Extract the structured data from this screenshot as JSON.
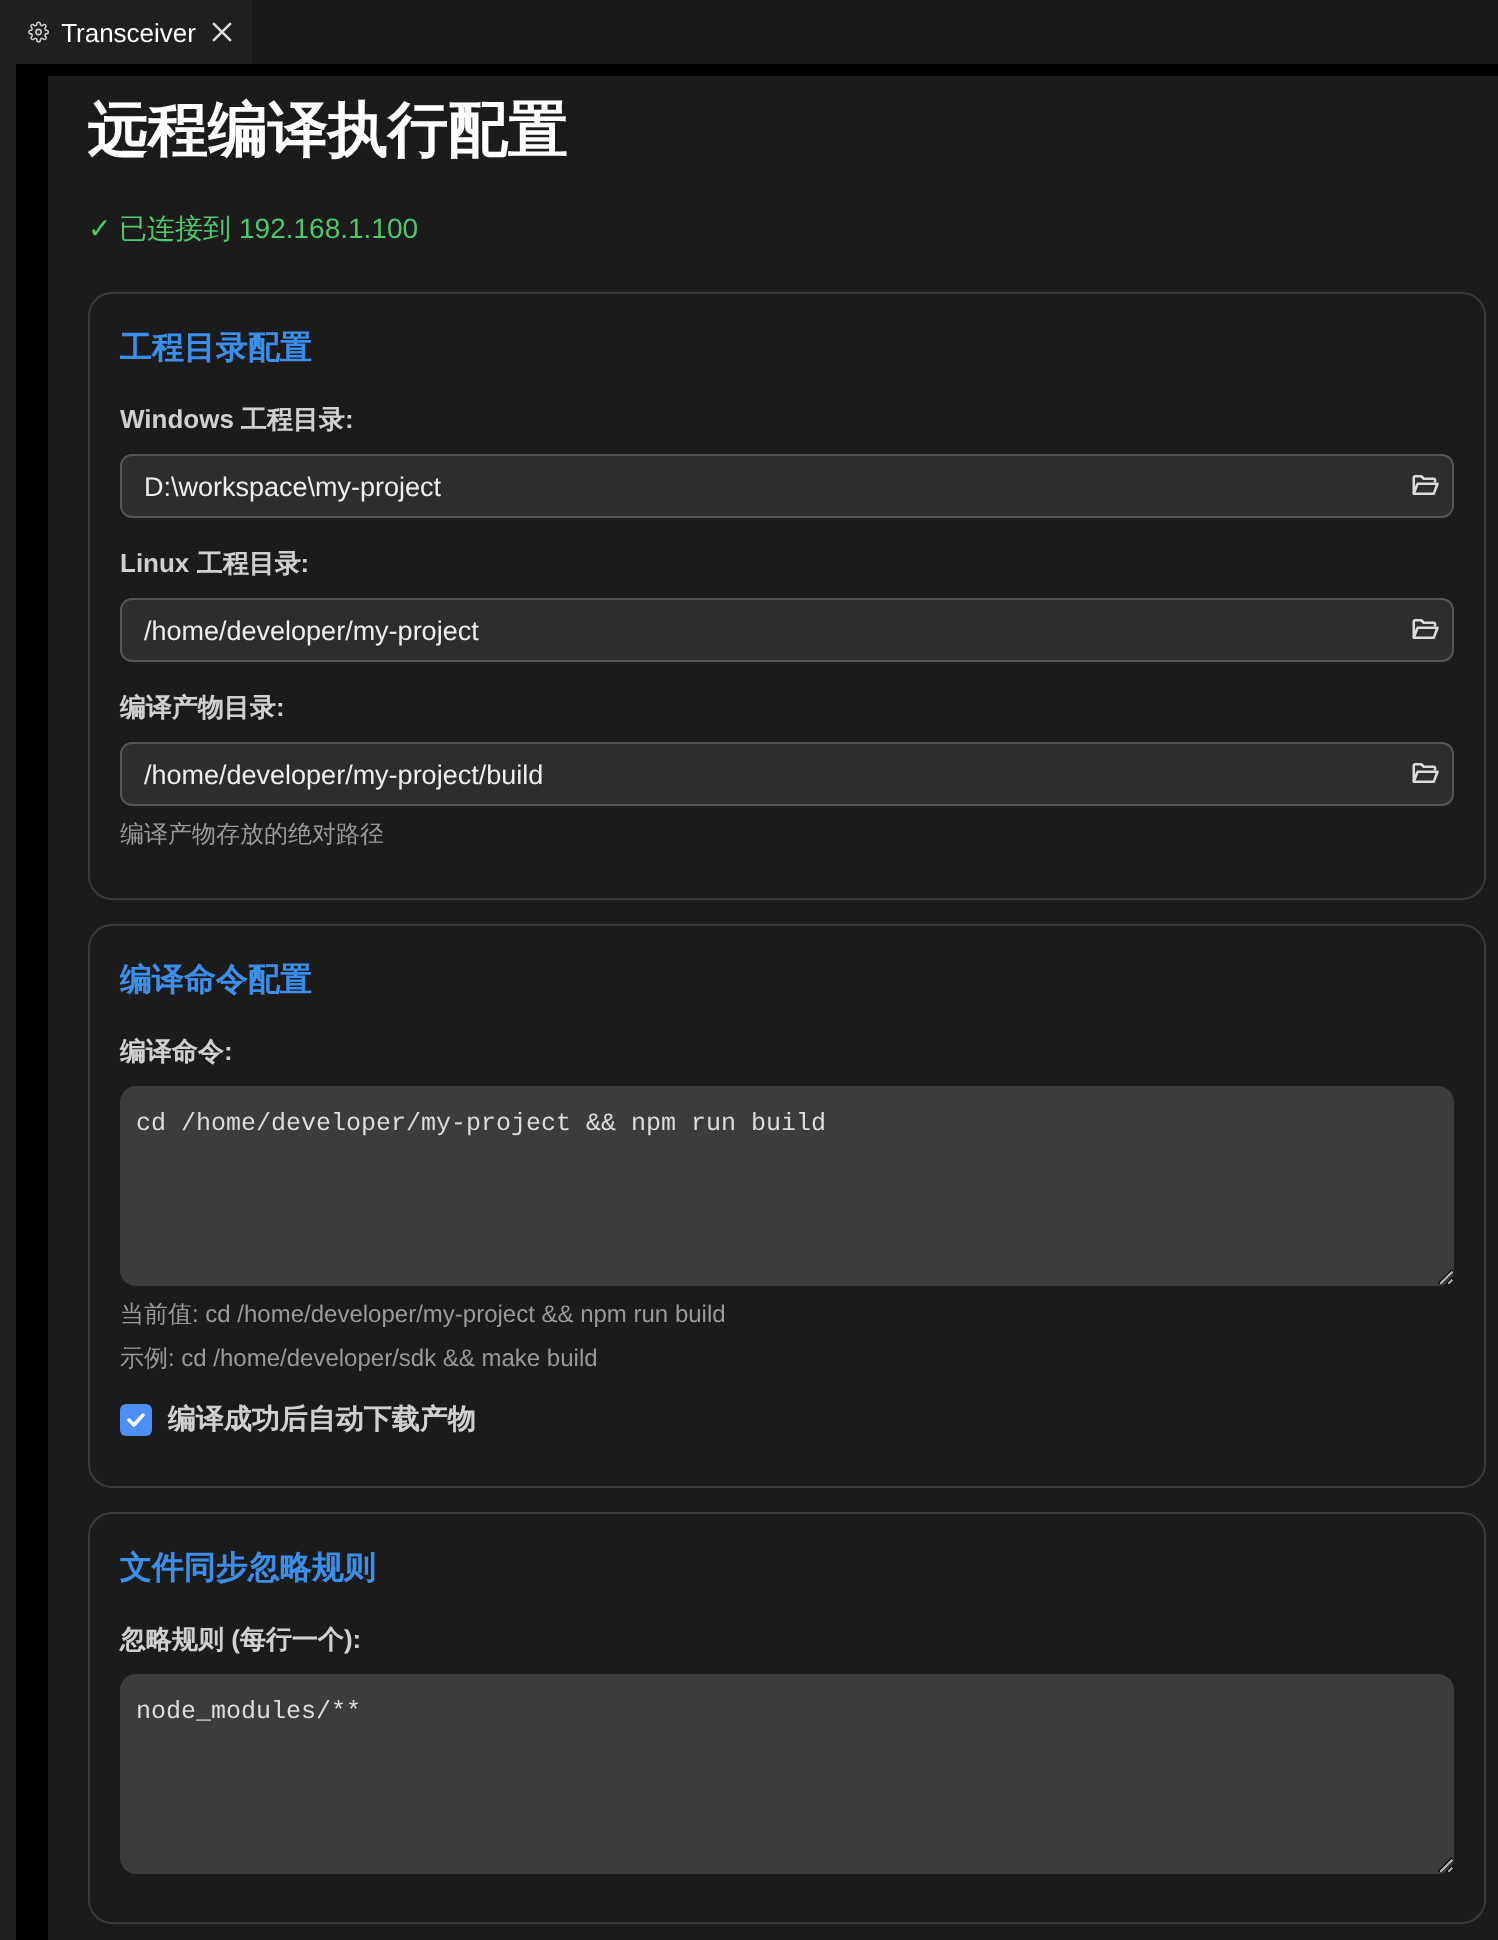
{
  "tab": {
    "title": "Transceiver",
    "selected": true
  },
  "page": {
    "title": "远程编译执行配置",
    "status": "✓ 已连接到 192.168.1.100"
  },
  "sections": [
    {
      "title": "工程目录配置",
      "fields": [
        {
          "kind": "path",
          "label": "Windows 工程目录:",
          "value": "D:\\workspace\\my-project"
        },
        {
          "kind": "path",
          "label": "Linux 工程目录:",
          "value": "/home/developer/my-project"
        },
        {
          "kind": "path",
          "label": "编译产物目录:",
          "value": "/home/developer/my-project/build",
          "hints": [
            "编译产物存放的绝对路径"
          ]
        }
      ]
    },
    {
      "title": "编译命令配置",
      "fields": [
        {
          "kind": "textarea",
          "label": "编译命令:",
          "value": "cd /home/developer/my-project && npm run build",
          "hints": [
            "当前值: cd /home/developer/my-project && npm run build",
            "示例: cd /home/developer/sdk && make build"
          ]
        },
        {
          "kind": "checkbox",
          "label": "编译成功后自动下载产物",
          "checked": true
        }
      ]
    },
    {
      "title": "文件同步忽略规则",
      "fields": [
        {
          "kind": "textarea",
          "label": "忽略规则 (每行一个):",
          "value": "node_modules/**"
        }
      ]
    }
  ]
}
